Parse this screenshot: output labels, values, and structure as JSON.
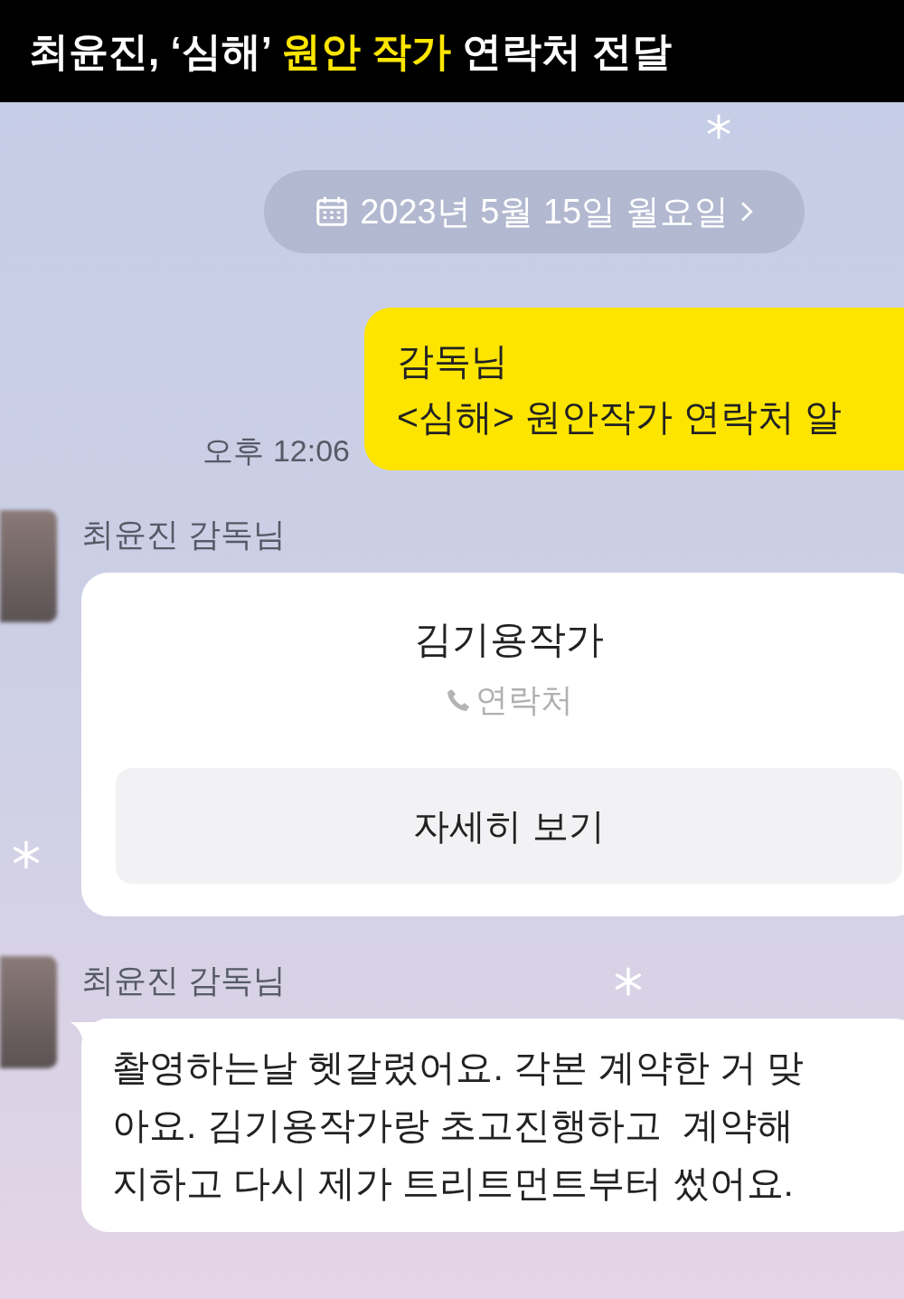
{
  "headline": [
    {
      "text": "최윤진, ‘심해’ ",
      "highlight": false
    },
    {
      "text": "원안 작가",
      "highlight": true
    },
    {
      "text": " 연락처 전달",
      "highlight": false
    }
  ],
  "date_divider": "2023년 5월 15일 월요일",
  "messages": [
    {
      "kind": "sent",
      "lines": [
        "감독님",
        "<심해> 원안작가 연락처 알"
      ],
      "time": "오후 12:06"
    },
    {
      "kind": "contact",
      "sender": "최윤진 감독님",
      "name": "김기용작가",
      "subtitle": "연락처",
      "button": "자세히 보기"
    },
    {
      "kind": "received",
      "sender": "최윤진 감독님",
      "lines": [
        "촬영하는날 헷갈렸어요. 각본 계약한 거 맞",
        "아요. 김기용작가랑 초고진행하고  계약해",
        "지하고 다시 제가 트리트먼트부터 썼어요."
      ]
    }
  ]
}
